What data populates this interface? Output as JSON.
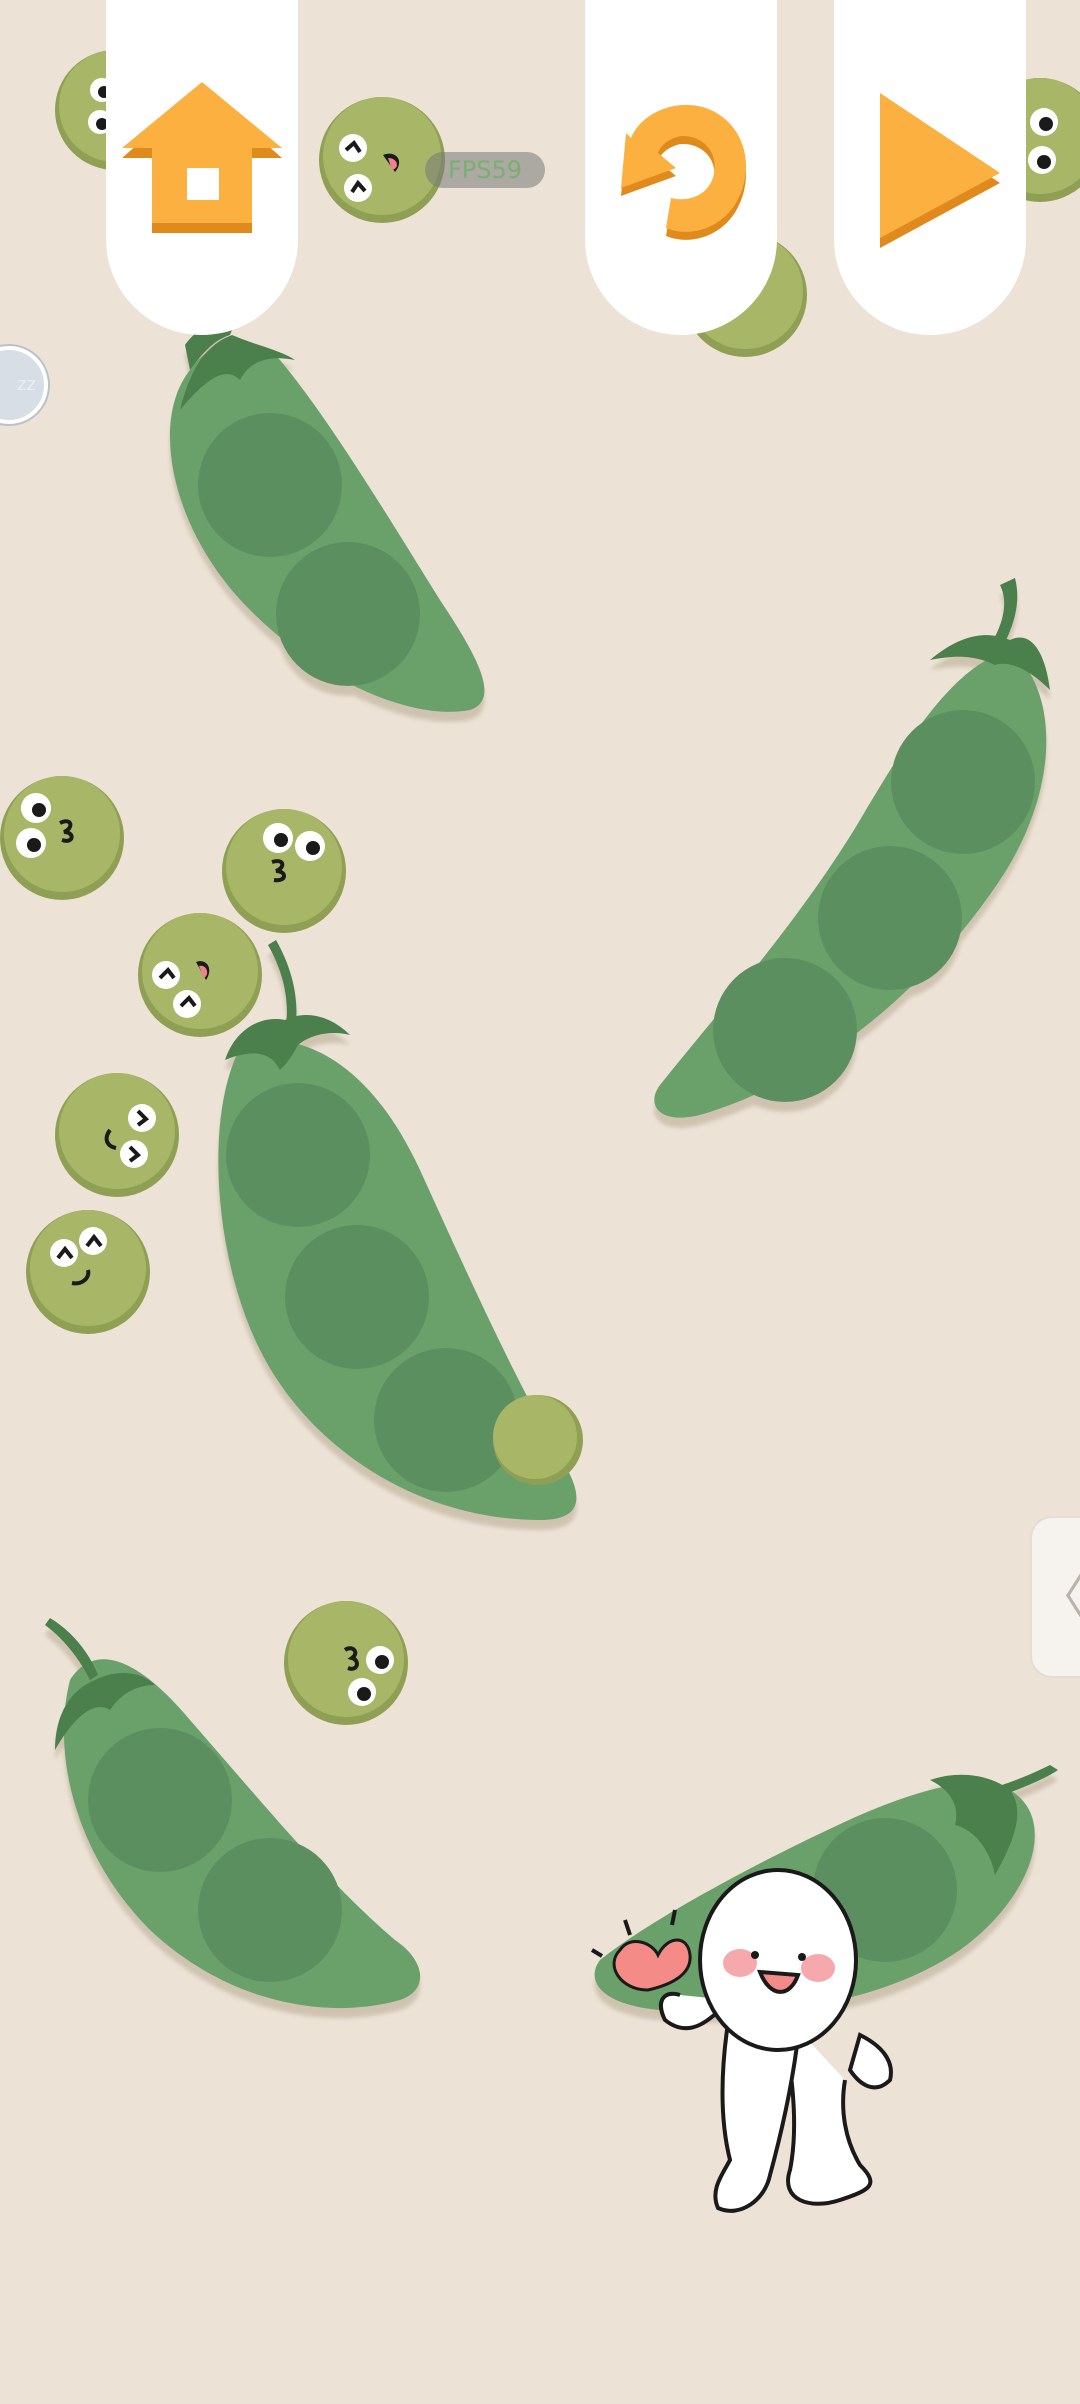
{
  "hud": {
    "fps_text": "FPS59",
    "sleep_badge_text": "zz",
    "side_handle_glyph": "〈"
  },
  "buttons": [
    {
      "name": "home-button",
      "icon": "home-arrow-icon"
    },
    {
      "name": "undo-button",
      "icon": "undo-arrow-icon"
    },
    {
      "name": "next-button",
      "icon": "play-triangle-icon"
    }
  ],
  "colors": {
    "background": "#ece3d6",
    "pod": "#6aa06b",
    "pod_seed": "#5c8f5e",
    "stem": "#4b7f4c",
    "pea": "#a7b767",
    "pea_rim": "#8fa054",
    "button_accent": "#fbb040",
    "button_accent_dark": "#e08a1e",
    "heart": "#f58b86"
  },
  "characters": {
    "mascot": "white-blob-character-with-heart"
  }
}
